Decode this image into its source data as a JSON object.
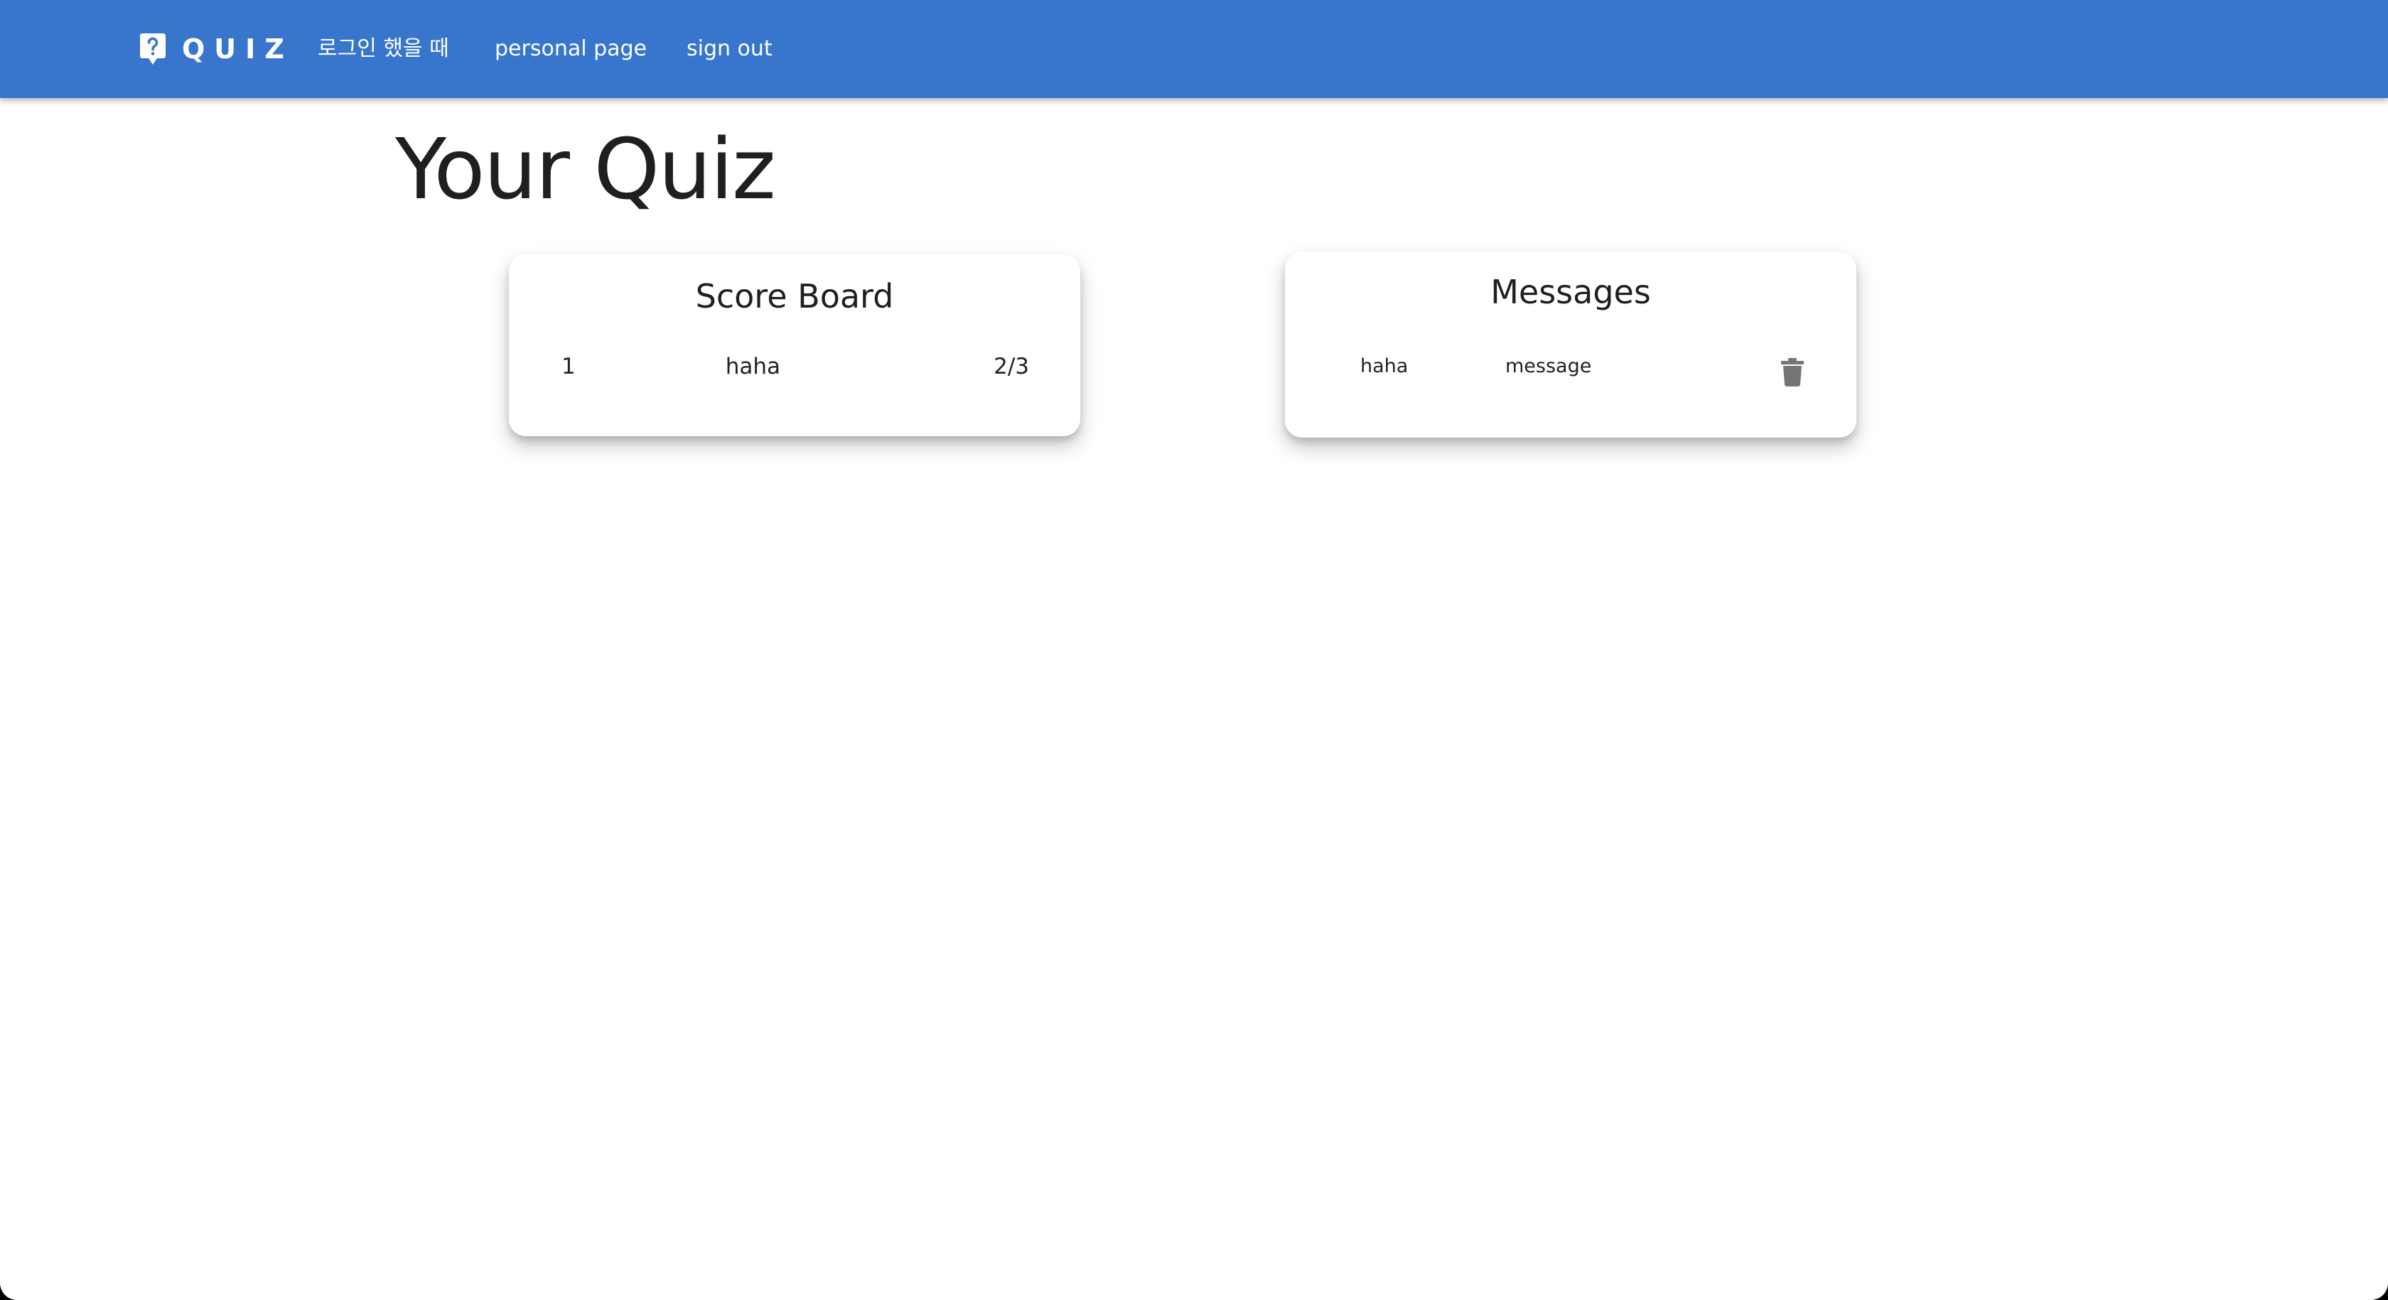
{
  "navbar": {
    "brand": "QUIZ",
    "links": [
      "로그인 했을 때",
      "personal page",
      "sign out"
    ]
  },
  "page": {
    "title": "Your Quiz"
  },
  "score_board": {
    "title": "Score Board",
    "rows": [
      {
        "rank": "1",
        "name": "haha",
        "score": "2/3"
      }
    ]
  },
  "messages": {
    "title": "Messages",
    "rows": [
      {
        "from": "haha",
        "text": "message",
        "action_icon": "trash-icon"
      }
    ]
  },
  "colors": {
    "app_bar": "#3776cc",
    "background": "#ffffff",
    "text": "#1f1f1f",
    "icon": "#757575"
  }
}
